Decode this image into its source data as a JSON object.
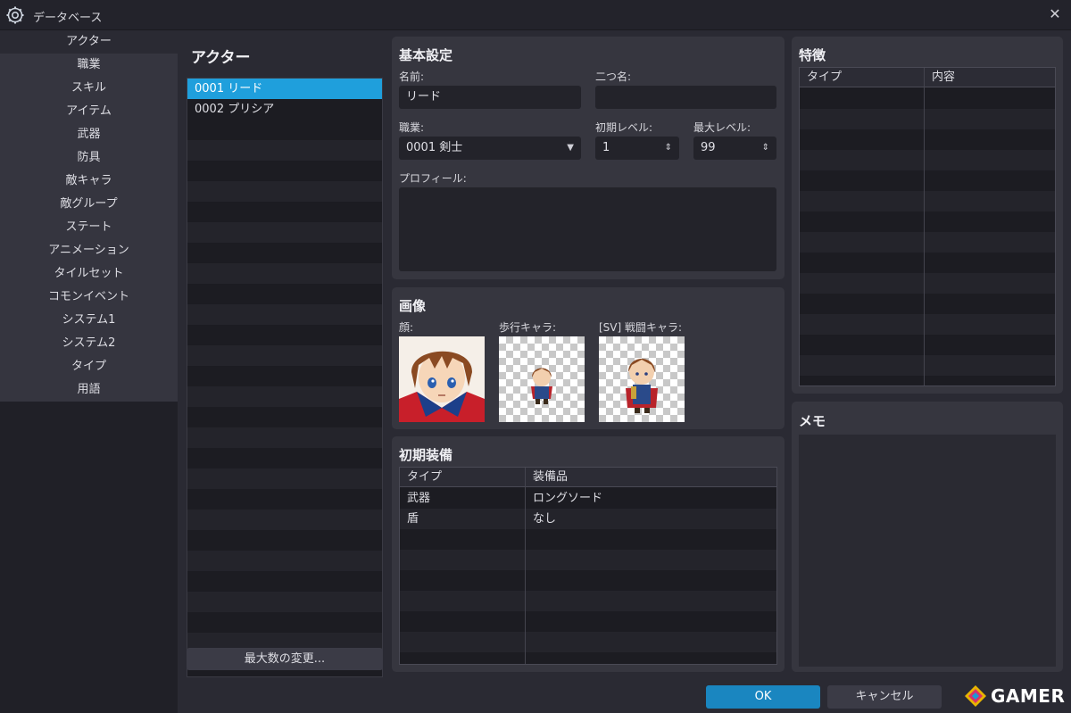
{
  "window": {
    "title": "データベース"
  },
  "sidebar": {
    "items": [
      {
        "label": "アクター",
        "active": true
      },
      {
        "label": "職業"
      },
      {
        "label": "スキル"
      },
      {
        "label": "アイテム"
      },
      {
        "label": "武器"
      },
      {
        "label": "防具"
      },
      {
        "label": "敵キャラ"
      },
      {
        "label": "敵グループ"
      },
      {
        "label": "ステート"
      },
      {
        "label": "アニメーション"
      },
      {
        "label": "タイルセット"
      },
      {
        "label": "コモンイベント"
      },
      {
        "label": "システム1"
      },
      {
        "label": "システム2"
      },
      {
        "label": "タイプ"
      },
      {
        "label": "用語"
      }
    ]
  },
  "actors": {
    "heading": "アクター",
    "items": [
      "0001 リード",
      "0002 プリシア"
    ],
    "selected_index": 0,
    "max_button": "最大数の変更..."
  },
  "basic": {
    "heading": "基本設定",
    "name_label": "名前:",
    "name_value": "リード",
    "nickname_label": "二つ名:",
    "nickname_value": "",
    "class_label": "職業:",
    "class_value": "0001 剣士",
    "init_level_label": "初期レベル:",
    "init_level_value": "1",
    "max_level_label": "最大レベル:",
    "max_level_value": "99",
    "profile_label": "プロフィール:",
    "profile_value": ""
  },
  "images": {
    "heading": "画像",
    "face_label": "顔:",
    "walk_label": "歩行キャラ:",
    "battler_label": "[SV] 戦闘キャラ:"
  },
  "equipment": {
    "heading": "初期装備",
    "col_type": "タイプ",
    "col_item": "装備品",
    "rows": [
      {
        "type": "武器",
        "item": "ロングソード"
      },
      {
        "type": "盾",
        "item": "なし"
      }
    ]
  },
  "traits": {
    "heading": "特徴",
    "col_type": "タイプ",
    "col_content": "内容"
  },
  "memo": {
    "heading": "メモ"
  },
  "footer": {
    "ok": "OK",
    "cancel": "キャンセル"
  },
  "watermark": {
    "text": "GAMER"
  },
  "colors": {
    "accent": "#1f9fdc",
    "ok_button": "#1a86c0",
    "background": "#2a2a33",
    "panel": "#36363f"
  },
  "icons": {
    "app": "gear-icon",
    "close": "close-icon",
    "dropdown": "chevron-down-icon",
    "spin": "updown-icon"
  }
}
